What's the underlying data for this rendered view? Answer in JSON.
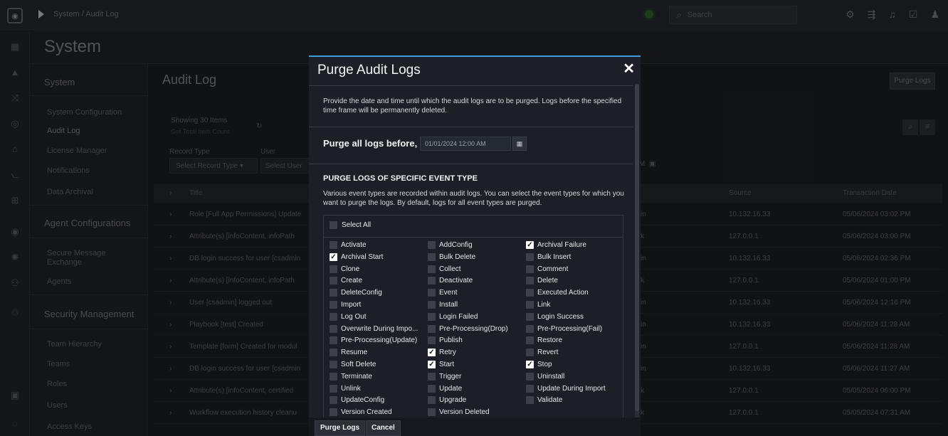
{
  "topbar": {
    "breadcrumb": "System / Audit Log",
    "search_placeholder": "Search"
  },
  "page": {
    "header_title": "System",
    "content_title": "Audit Log",
    "purge_button": "Purge Logs"
  },
  "subnav": {
    "sections": [
      "System",
      "Agent Configurations",
      "Security Management"
    ],
    "system_items": [
      "System Configuration",
      "Audit Log",
      "License Manager",
      "Notifications",
      "Data Archival"
    ],
    "agent_items": [
      "Secure Message Exchange",
      "Agents"
    ],
    "security_items": [
      "Team Hierarchy",
      "Teams",
      "Roles",
      "Users",
      "Access Keys"
    ]
  },
  "list": {
    "showing": "Showing 30 Items",
    "get_total": "Get Total Item Count",
    "record_type_label": "Record Type",
    "user_label": "User",
    "record_type_select": "Select Record Type",
    "user_select": "Select User",
    "headers": {
      "title": "Title",
      "source": "Source",
      "date": "Transaction Date"
    },
    "rows": [
      {
        "title": "Role [Full App Permissions] Update",
        "mid": "in",
        "source": "10.132.16.33",
        "date": "05/06/2024 03:02 PM"
      },
      {
        "title": "Attribute(s) [infoContent, infoPath",
        "mid": "k",
        "source": "127.0.0.1",
        "date": "05/06/2024 03:00 PM"
      },
      {
        "title": "DB login success for user [csadmin",
        "mid": "in",
        "source": "10.132.16.33",
        "date": "05/06/2024 02:36 PM"
      },
      {
        "title": "Attribute(s) [infoContent, infoPath",
        "mid": "k",
        "source": "127.0.0.1",
        "date": "05/06/2024 01:00 PM"
      },
      {
        "title": "User [csadmin] logged out",
        "mid": "in",
        "source": "10.132.16.33",
        "date": "05/06/2024 12:16 PM"
      },
      {
        "title": "Playbook [test] Created",
        "mid": "in",
        "source": "10.132.16.33",
        "date": "05/06/2024 11:28 AM"
      },
      {
        "title": "Template [form] Created for modul",
        "mid": "in",
        "source": "127.0.0.1",
        "date": "05/06/2024 11:28 AM"
      },
      {
        "title": "DB login success for user [csadmin",
        "mid": "in",
        "source": "10.132.16.33",
        "date": "05/06/2024 11:27 AM"
      },
      {
        "title": "Attribute(s) [infoContent, certified",
        "mid": "k",
        "source": "127.0.0.1",
        "date": "05/05/2024 06:00 PM"
      },
      {
        "title": "Workflow execution history cleanu",
        "mid": "k",
        "source": "127.0.0.1",
        "date": "05/05/2024 07:31 AM"
      }
    ]
  },
  "modal": {
    "title": "Purge Audit Logs",
    "description": "Provide the date and time until which the audit logs are to be purged. Logs before the specified time frame will be permanently deleted.",
    "purge_before_label": "Purge all logs before,",
    "purge_before_value": "01/01/2024 12:00 AM",
    "section_title": "PURGE LOGS OF SPECIFIC EVENT TYPE",
    "section_desc": "Various event types are recorded within audit logs. You can select the event types for which you want to purge the logs. By default, logs for all event types are purged.",
    "select_all": "Select All",
    "events": [
      {
        "label": "Activate",
        "checked": false
      },
      {
        "label": "AddConfig",
        "checked": false
      },
      {
        "label": "Archival Failure",
        "checked": true
      },
      {
        "label": "Archival Start",
        "checked": true
      },
      {
        "label": "Bulk Delete",
        "checked": false
      },
      {
        "label": "Bulk Insert",
        "checked": false
      },
      {
        "label": "Clone",
        "checked": false
      },
      {
        "label": "Collect",
        "checked": false
      },
      {
        "label": "Comment",
        "checked": false
      },
      {
        "label": "Create",
        "checked": false
      },
      {
        "label": "Deactivate",
        "checked": false
      },
      {
        "label": "Delete",
        "checked": false
      },
      {
        "label": "DeleteConfig",
        "checked": false
      },
      {
        "label": "Event",
        "checked": false
      },
      {
        "label": "Executed Action",
        "checked": false
      },
      {
        "label": "Import",
        "checked": false
      },
      {
        "label": "Install",
        "checked": false
      },
      {
        "label": "Link",
        "checked": false
      },
      {
        "label": "Log Out",
        "checked": false
      },
      {
        "label": "Login Failed",
        "checked": false
      },
      {
        "label": "Login Success",
        "checked": false
      },
      {
        "label": "Overwrite During Impo...",
        "checked": false
      },
      {
        "label": "Pre-Processing(Drop)",
        "checked": false
      },
      {
        "label": "Pre-Processing(Fail)",
        "checked": false
      },
      {
        "label": "Pre-Processing(Update)",
        "checked": false
      },
      {
        "label": "Publish",
        "checked": false
      },
      {
        "label": "Restore",
        "checked": false
      },
      {
        "label": "Resume",
        "checked": false
      },
      {
        "label": "Retry",
        "checked": true
      },
      {
        "label": "Revert",
        "checked": false
      },
      {
        "label": "Soft Delete",
        "checked": false
      },
      {
        "label": "Start",
        "checked": true
      },
      {
        "label": "Stop",
        "checked": true
      },
      {
        "label": "Terminate",
        "checked": false
      },
      {
        "label": "Trigger",
        "checked": false
      },
      {
        "label": "Uninstall",
        "checked": false
      },
      {
        "label": "Unlink",
        "checked": false
      },
      {
        "label": "Update",
        "checked": false
      },
      {
        "label": "Update During Import",
        "checked": false
      },
      {
        "label": "UpdateConfig",
        "checked": false
      },
      {
        "label": "Upgrade",
        "checked": false
      },
      {
        "label": "Validate",
        "checked": false
      },
      {
        "label": "Version Created",
        "checked": false
      },
      {
        "label": "Version Deleted",
        "checked": false
      }
    ],
    "purge_button": "Purge Logs",
    "cancel_button": "Cancel"
  },
  "colors": {
    "accent": "#3a9fd9",
    "modal_bg": "#1c2026",
    "page_bg": "#1b1d22"
  }
}
